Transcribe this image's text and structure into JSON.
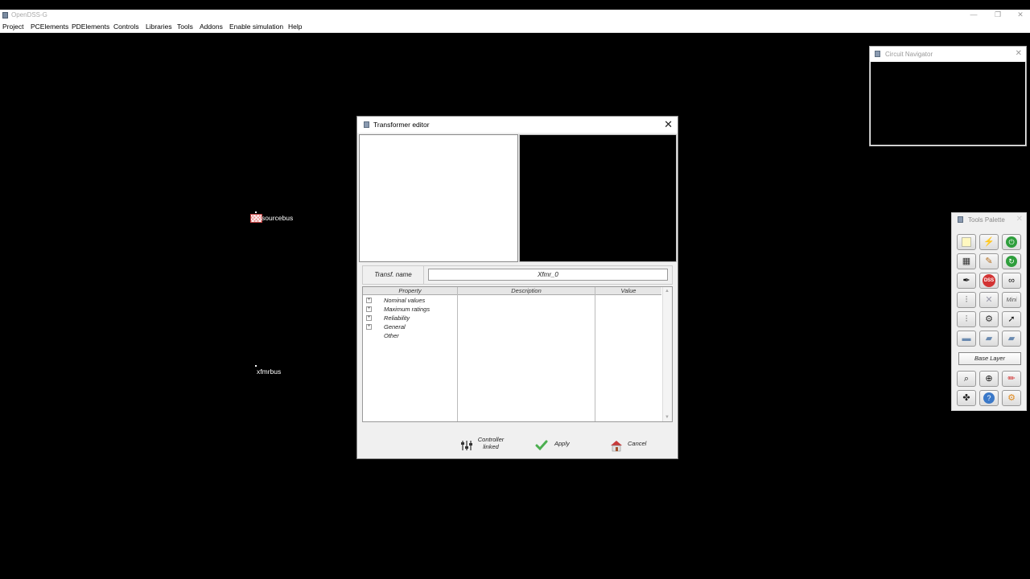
{
  "app": {
    "title": "OpenDSS-G",
    "window_controls": {
      "minimize": "—",
      "restore": "❐",
      "close": "✕"
    }
  },
  "menu": [
    "Project",
    "PCElements",
    "PDElements",
    "Controls",
    "Libraries",
    "Tools",
    "Addons",
    "Enable simulation",
    "Help"
  ],
  "canvas": {
    "buses": [
      {
        "label": "sourcebus"
      },
      {
        "label": "xfmrbus"
      }
    ]
  },
  "circuit_navigator": {
    "title": "Circuit Navigator",
    "close": "✕"
  },
  "dialog": {
    "title": "Transformer editor",
    "close": "✕",
    "name_label": "Transf. name",
    "name_value": "Xfmr_0",
    "columns": [
      "Property",
      "Description",
      "Value"
    ],
    "rows": [
      {
        "label": "Nominal values",
        "expandable": true
      },
      {
        "label": "Maximum ratings",
        "expandable": true
      },
      {
        "label": "Reliability",
        "expandable": true
      },
      {
        "label": "General",
        "expandable": true
      },
      {
        "label": "Other",
        "expandable": false
      }
    ],
    "buttons": {
      "controller": "Controller linked",
      "controller_line1": "Controller",
      "controller_line2": "linked",
      "apply": "Apply",
      "cancel": "Cancel"
    }
  },
  "tools_palette": {
    "title": "Tools Palette",
    "close": "✕",
    "mini_label": "Mini",
    "base_layer": "Base Layer",
    "dss_label": "DSS"
  },
  "colors": {
    "background": "#000000",
    "accent_green": "#2e9e3c",
    "accent_red": "#d33333",
    "apply_green": "#4caf50",
    "cancel_red": "#c83a3a"
  }
}
